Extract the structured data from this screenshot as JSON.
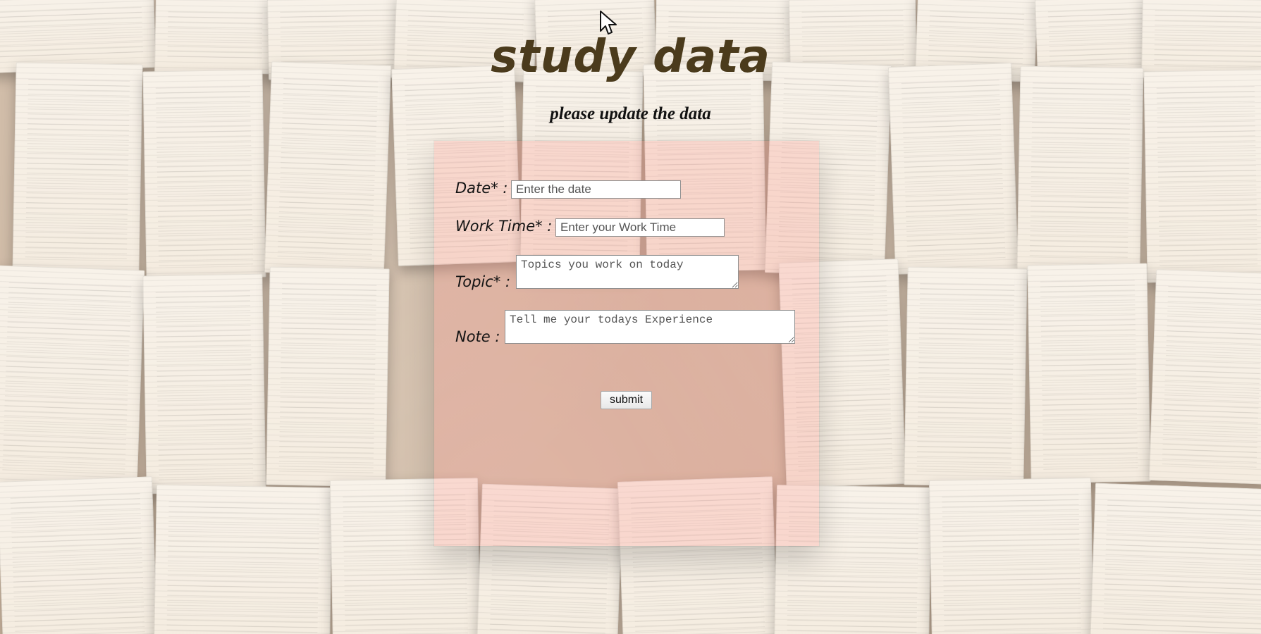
{
  "page": {
    "title": "study data",
    "subtitle": "please update the data"
  },
  "form": {
    "date_label": "Date* :",
    "date_placeholder": "Enter the date",
    "work_time_label": "Work Time* :",
    "work_time_placeholder": "Enter your Work Time",
    "topic_label": "Topic* :",
    "topic_placeholder": "Topics you work on today",
    "note_label": "Note :",
    "note_placeholder": "Tell me your todays Experience",
    "submit_label": "submit"
  },
  "icons": {
    "cursor": "mouse-pointer-icon"
  },
  "colors": {
    "title": "#4b3b1c",
    "panel_tint": "rgba(255, 140, 130, 0.24)"
  }
}
